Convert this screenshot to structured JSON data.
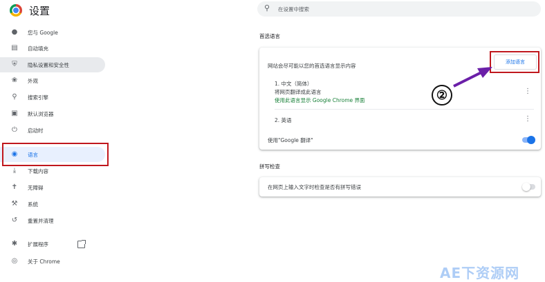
{
  "header": {
    "title": "设置",
    "search_placeholder": "在设置中搜索"
  },
  "sidebar": {
    "items": [
      {
        "label": "您与 Google",
        "icon": "person-icon"
      },
      {
        "label": "自动填充",
        "icon": "clipboard-icon"
      },
      {
        "label": "隐私设置和安全性",
        "icon": "shield-icon"
      },
      {
        "label": "外观",
        "icon": "palette-icon"
      },
      {
        "label": "搜索引擎",
        "icon": "search-icon"
      },
      {
        "label": "默认浏览器",
        "icon": "browser-icon"
      },
      {
        "label": "启动时",
        "icon": "power-icon"
      },
      {
        "label": "语言",
        "icon": "globe-icon"
      },
      {
        "label": "下载内容",
        "icon": "download-icon"
      },
      {
        "label": "无障碍",
        "icon": "accessibility-icon"
      },
      {
        "label": "系统",
        "icon": "wrench-icon"
      },
      {
        "label": "重置并清理",
        "icon": "reset-icon"
      },
      {
        "label": "扩展程序",
        "icon": "puzzle-icon"
      },
      {
        "label": "关于 Chrome",
        "icon": "chrome-icon"
      }
    ]
  },
  "languages": {
    "section_title": "首选语言",
    "description": "网站会尽可能以您的首选语言显示内容",
    "add_button": "添加语言",
    "list": [
      {
        "name": "1. 中文（简体）",
        "line2": "将网页翻译成此语言",
        "line3": "使用此语言显示 Google Chrome 界面"
      },
      {
        "name": "2. 英语"
      }
    ],
    "translate_label": "使用\"Google 翻译\"",
    "translate_on": true
  },
  "spellcheck": {
    "section_title": "拼写检查",
    "label": "在网页上输入文字时检查是否有拼写错误",
    "on": false
  },
  "annotation": {
    "step_number": "②"
  },
  "watermark": "AE下资源网",
  "colors": {
    "accent": "#1a73e8",
    "highlight": "#c0171d",
    "arrow": "#6b1fa8",
    "link_green": "#188038"
  }
}
